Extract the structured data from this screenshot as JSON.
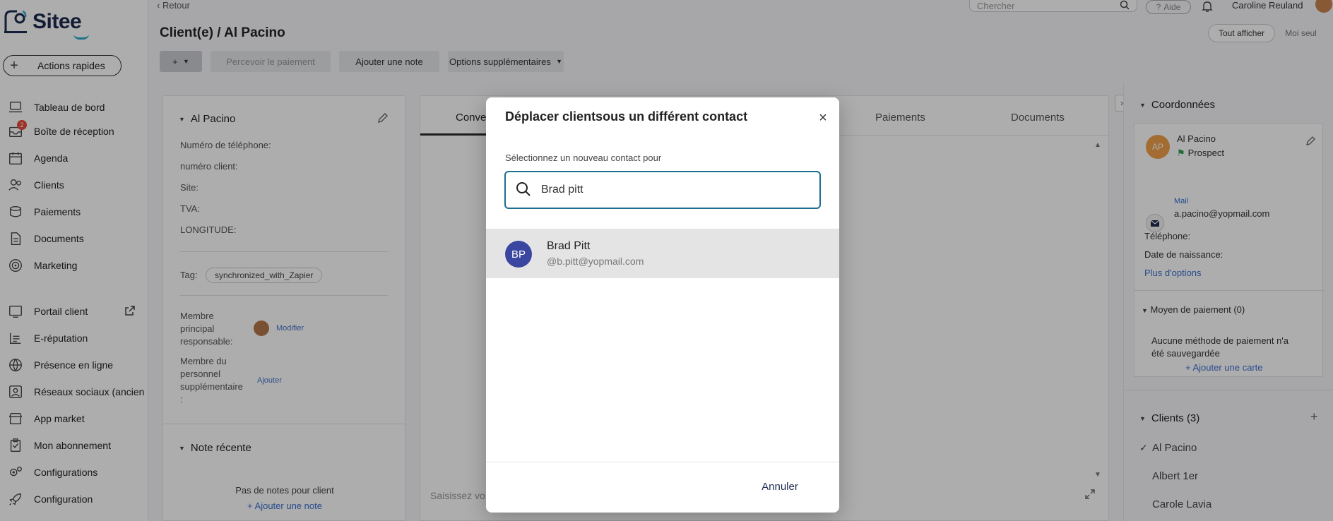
{
  "sidebar": {
    "logo_text": "Sitee",
    "quick_actions": "Actions rapides",
    "items": [
      {
        "label": "Tableau de bord",
        "icon": "dashboard-icon"
      },
      {
        "label": "Boîte de réception",
        "icon": "inbox-icon",
        "badge": "2"
      },
      {
        "label": "Agenda",
        "icon": "calendar-icon"
      },
      {
        "label": "Clients",
        "icon": "users-icon"
      },
      {
        "label": "Paiements",
        "icon": "payments-icon"
      },
      {
        "label": "Documents",
        "icon": "document-icon"
      },
      {
        "label": "Marketing",
        "icon": "target-icon"
      },
      {
        "label": "Portail client",
        "icon": "portal-icon"
      },
      {
        "label": "E-réputation",
        "icon": "reputation-icon"
      },
      {
        "label": "Présence en ligne",
        "icon": "globe-icon"
      },
      {
        "label": "Réseaux sociaux (ancien",
        "icon": "social-icon"
      },
      {
        "label": "App market",
        "icon": "store-icon"
      },
      {
        "label": "Mon abonnement",
        "icon": "subscription-icon"
      },
      {
        "label": "Configurations",
        "icon": "gears-icon"
      },
      {
        "label": "Configuration",
        "icon": "rocket-icon"
      }
    ]
  },
  "header": {
    "back": "Retour",
    "search_placeholder": "Chercher",
    "help": "Aide",
    "user_name": "Caroline Reuland",
    "page_title": "Client(e) / Al Pacino",
    "view_all": "Tout afficher",
    "view_me": "Moi seul"
  },
  "toolbar": {
    "add": "+",
    "collect_payment": "Percevoir le paiement",
    "add_note": "Ajouter une note",
    "more_options": "Options supplémentaires"
  },
  "client_panel": {
    "name": "Al Pacino",
    "phone_label": "Numéro de téléphone:",
    "client_number_label": "numéro client:",
    "site_label": "Site:",
    "tva_label": "TVA:",
    "longitude_label": "LONGITUDE:",
    "tag_label": "Tag:",
    "tag_value": "synchronized_with_Zapier",
    "main_member_label_1": "Membre",
    "main_member_label_2": "principal",
    "main_member_label_3": "responsable:",
    "modify": "Modifier",
    "extra_member_label_1": "Membre du",
    "extra_member_label_2": "personnel",
    "extra_member_label_3": "supplémentaire",
    "extra_member_label_4": ":",
    "add": "Ajouter",
    "recent_note_title": "Note récente",
    "no_notes": "Pas de notes pour client",
    "add_note": "+ Ajouter une note"
  },
  "center_panel": {
    "tab_conversations": "Conve",
    "tab_payments": "Paiements",
    "tab_documents": "Documents",
    "input_placeholder": "Saisissez vo"
  },
  "right_panel": {
    "coordinates_title": "Coordonnées",
    "avatar_initials": "AP",
    "name": "Al Pacino",
    "status": "Prospect",
    "mail_label": "Mail",
    "email": "a.pacino@yopmail.com",
    "phone_label": "Téléphone:",
    "birthdate_label": "Date de naissance:",
    "more_options": "Plus d'options",
    "payment_method_title": "Moyen de paiement (0)",
    "no_payment_1": "Aucune méthode de paiement n'a",
    "no_payment_2": "été sauvegardée",
    "add_card": "+ Ajouter une carte",
    "clients_title": "Clients (3)",
    "clients_add": "+",
    "clients": [
      "Al Pacino",
      "Albert 1er",
      "Carole Lavia"
    ]
  },
  "modal": {
    "title": "Déplacer clientsous un différent contact",
    "label": "Sélectionnez un nouveau contact pour",
    "search_value": "Brad pitt",
    "result": {
      "initials": "BP",
      "name": "Brad Pitt",
      "email": "@b.pitt@yopmail.com"
    },
    "cancel": "Annuler"
  }
}
